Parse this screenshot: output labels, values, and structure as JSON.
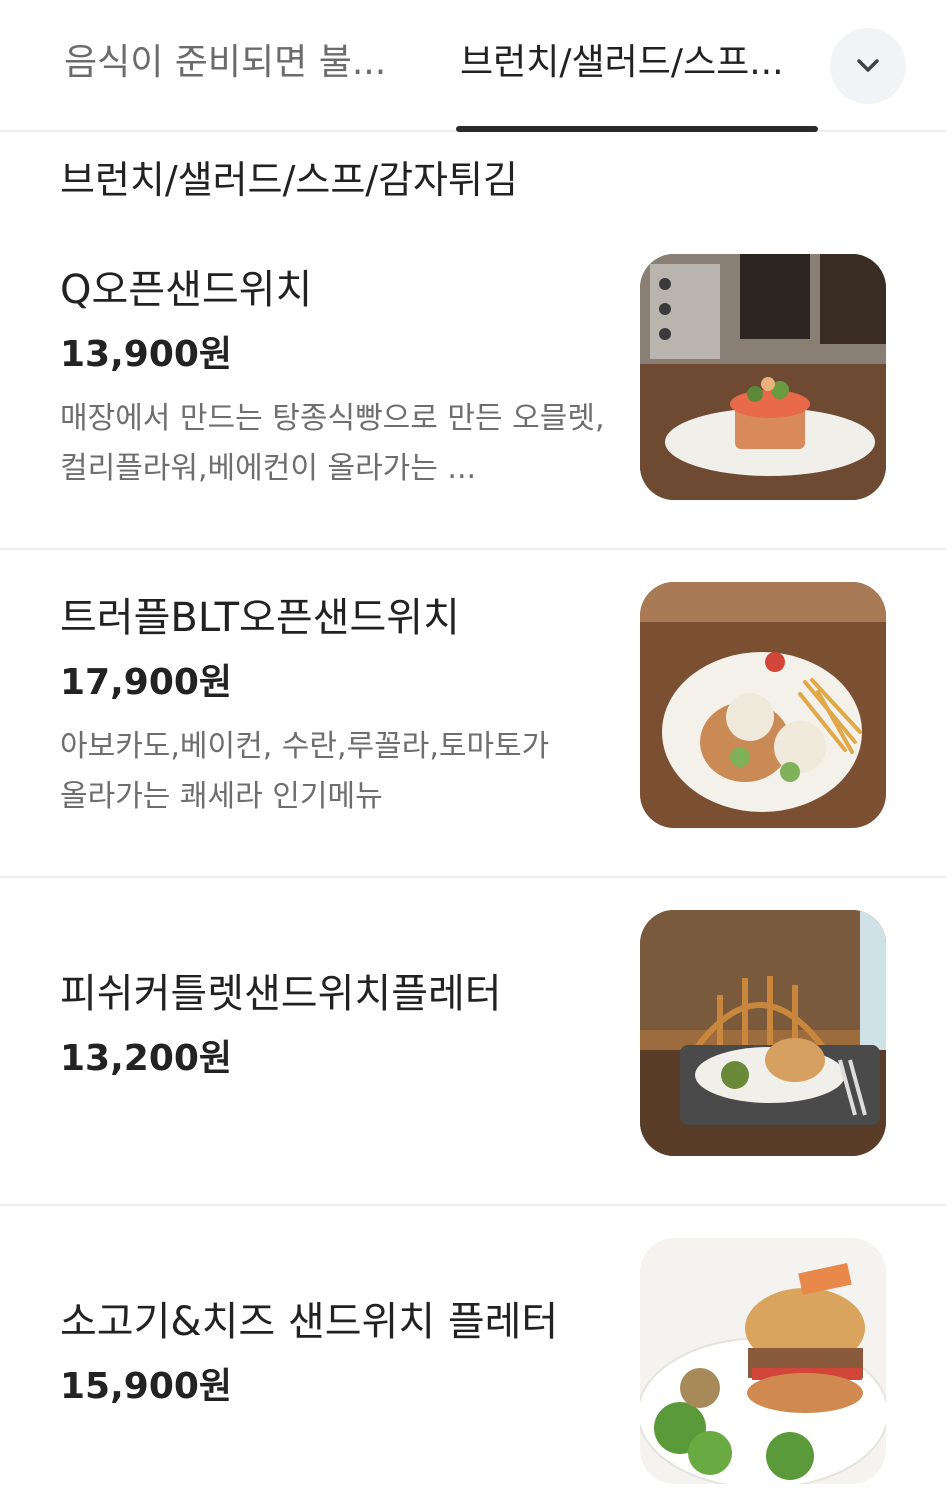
{
  "tabs": [
    {
      "label": "음식이 준비되면 불...",
      "active": false
    },
    {
      "label": "브런치/샐러드/스프...",
      "active": true
    }
  ],
  "expand_icon": "chevron-down-icon",
  "section": {
    "title": "브런치/샐러드/스프/감자튀김"
  },
  "items": [
    {
      "name": "Q오픈샌드위치",
      "price": "13,900원",
      "desc_lines": [
        "매장에서 만드는 탕종식빵으로 만든 오믈렛,",
        "컬리플라워,베에컨이 올라가는 ..."
      ]
    },
    {
      "name": "트러플BLT오픈샌드위치",
      "price": "17,900원",
      "desc_lines": [
        "아보카도,베이컨, 수란,루꼴라,토마토가",
        "올라가는 쾌세라 인기메뉴"
      ]
    },
    {
      "name": "피쉬커틀렛샌드위치플레터",
      "price": "13,200원",
      "desc_lines": []
    },
    {
      "name": "소고기&치즈 샌드위치 플레터",
      "price": "15,900원",
      "desc_lines": []
    }
  ],
  "colors": {
    "text_primary": "#222222",
    "text_secondary": "#6e6e6e",
    "divider": "#efefef",
    "indicator": "#2a2a2a",
    "button_bg": "#f2f3f5"
  }
}
